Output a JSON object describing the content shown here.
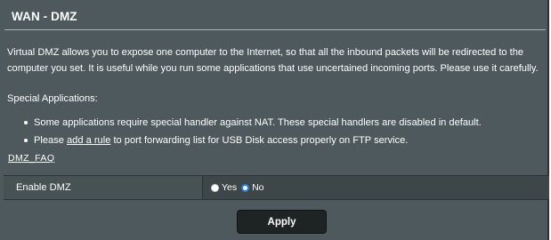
{
  "page": {
    "title": "WAN - DMZ",
    "description": "Virtual DMZ allows you to expose one computer to the Internet, so that all the inbound packets will be redirected to the computer you set. It is useful while you run some applications that use uncertained incoming ports. Please use it carefully.",
    "special_label": "Special Applications:",
    "bullet1": "Some applications require special handler against NAT. These special handlers are disabled in default.",
    "bullet2_before": "Please ",
    "bullet2_link": "add a rule",
    "bullet2_after": " to port forwarding list for USB Disk access properly on FTP service.",
    "faq_link": "DMZ_FAQ"
  },
  "form": {
    "enable_dmz_label": "Enable DMZ",
    "options": [
      {
        "label": "Yes",
        "checked": false
      },
      {
        "label": "No",
        "checked": true
      }
    ]
  },
  "actions": {
    "apply_label": "Apply"
  },
  "colors": {
    "background": "#4d595d",
    "row_background": "#3d4648",
    "button": "#1e2324",
    "radio_selected": "#2a7de1"
  }
}
